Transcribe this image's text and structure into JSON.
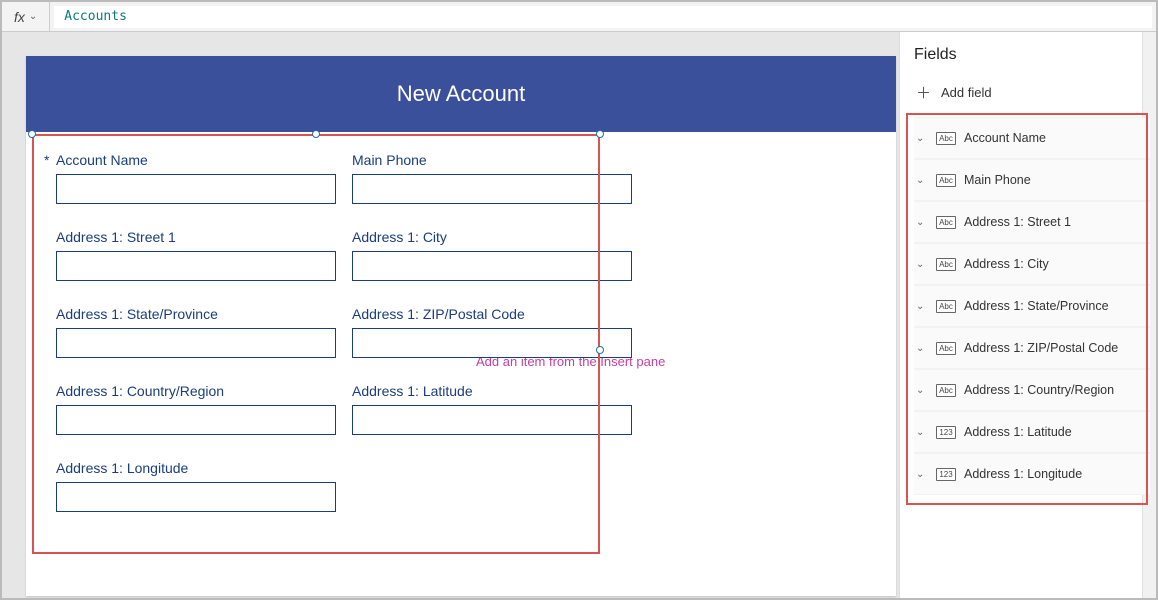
{
  "formula_bar": {
    "fx_label": "fx",
    "value": "Accounts"
  },
  "form": {
    "title": "New Account",
    "placeholder_hint": "Add an item from the Insert pane",
    "fields": [
      {
        "label": "Account Name",
        "required": true
      },
      {
        "label": "Main Phone",
        "required": false
      },
      {
        "label": "Address 1: Street 1",
        "required": false
      },
      {
        "label": "Address 1: City",
        "required": false
      },
      {
        "label": "Address 1: State/Province",
        "required": false
      },
      {
        "label": "Address 1: ZIP/Postal Code",
        "required": false
      },
      {
        "label": "Address 1: Country/Region",
        "required": false
      },
      {
        "label": "Address 1: Latitude",
        "required": false
      },
      {
        "label": "Address 1: Longitude",
        "required": false
      }
    ]
  },
  "fields_panel": {
    "title": "Fields",
    "add_field_label": "Add field",
    "items": [
      {
        "label": "Account Name",
        "type_badge": "Abc"
      },
      {
        "label": "Main Phone",
        "type_badge": "Abc"
      },
      {
        "label": "Address 1: Street 1",
        "type_badge": "Abc"
      },
      {
        "label": "Address 1: City",
        "type_badge": "Abc"
      },
      {
        "label": "Address 1: State/Province",
        "type_badge": "Abc"
      },
      {
        "label": "Address 1: ZIP/Postal Code",
        "type_badge": "Abc"
      },
      {
        "label": "Address 1: Country/Region",
        "type_badge": "Abc"
      },
      {
        "label": "Address 1: Latitude",
        "type_badge": "123"
      },
      {
        "label": "Address 1: Longitude",
        "type_badge": "123"
      }
    ]
  }
}
